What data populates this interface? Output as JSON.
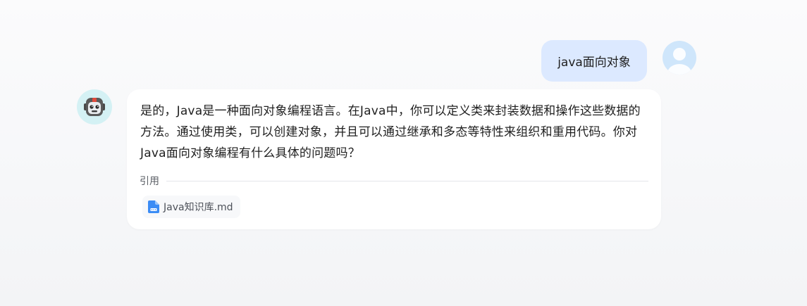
{
  "messages": {
    "user": {
      "text": "java面向对象",
      "avatar_icon": "user-avatar-icon"
    },
    "bot": {
      "text": "是的，Java是一种面向对象编程语言。在Java中，你可以定义类来封装数据和操作这些数据的方法。通过使用类，可以创建对象，并且可以通过继承和多态等特性来组织和重用代码。你对Java面向对象编程有什么具体的问题吗？",
      "avatar_icon": "robot-avatar-icon",
      "references": {
        "label": "引用",
        "files": [
          {
            "name": "Java知识库.md",
            "icon": "markdown-file-icon"
          }
        ]
      }
    }
  },
  "colors": {
    "user_bubble": "#dce9ff",
    "card_background": "#ffffff",
    "page_background": "#f6f7f9",
    "file_icon": "#3b8cf5"
  }
}
